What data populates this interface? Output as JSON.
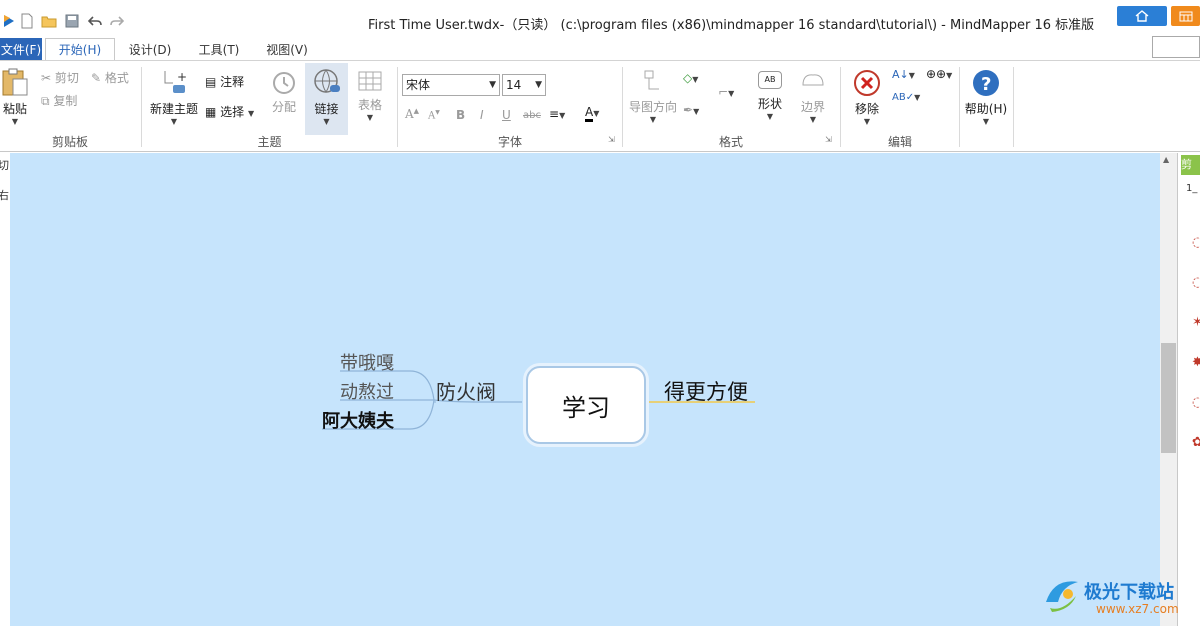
{
  "window": {
    "title": "First Time User.twdx-（只读） (c:\\program files (x86)\\mindmapper 16 standard\\tutorial\\) - MindMapper 16 标准版"
  },
  "tabs": [
    {
      "label": "文件(F)"
    },
    {
      "label": "开始(H)"
    },
    {
      "label": "设计(D)"
    },
    {
      "label": "工具(T)"
    },
    {
      "label": "视图(V)"
    }
  ],
  "ribbon": {
    "clipboard": {
      "label": "剪贴板",
      "paste": "粘贴",
      "cut": "剪切",
      "format": "格式",
      "copy": "复制"
    },
    "topic": {
      "label": "主题",
      "new_topic": "新建主题",
      "note": "注释",
      "select": "选择",
      "split": "分配",
      "link": "链接",
      "table": "表格"
    },
    "font": {
      "label": "字体",
      "family": "宋体",
      "size": "14"
    },
    "format": {
      "label": "格式",
      "direction": "导图方向",
      "shape": "形状",
      "border": "边界",
      "shape_badge": "AB"
    },
    "edit": {
      "label": "编辑",
      "remove": "移除"
    },
    "help": {
      "label": "帮助(H)"
    }
  },
  "left_strip": {
    "chars": [
      "切",
      "右"
    ]
  },
  "right_panel": {
    "tab": "剪",
    "field": "1_"
  },
  "mindmap": {
    "central": "学习",
    "right_topics": [
      "得更方便"
    ],
    "left_topic": "防火阀",
    "left_subtopics": [
      "带哦嘎",
      "动熬过",
      "阿大姨夫"
    ]
  },
  "watermark": {
    "name": "极光下载站",
    "url": "www.xz7.com"
  },
  "colors": {
    "canvas": "#c6e4fc",
    "accent": "#2b66b8",
    "right_branch": "#f2c94c",
    "left_branch": "#8fb4d8"
  }
}
